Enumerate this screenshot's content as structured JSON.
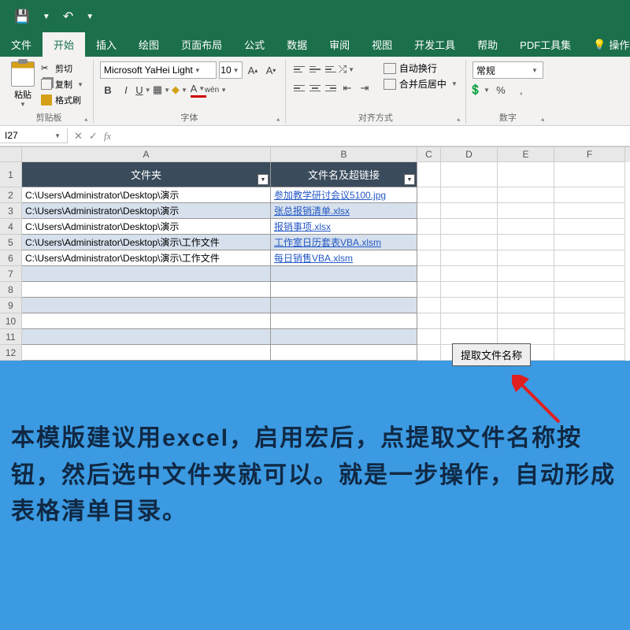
{
  "title_bar": {
    "save_icon": "💾",
    "undo_icon": "↶"
  },
  "tabs": {
    "file": "文件",
    "home": "开始",
    "insert": "插入",
    "draw": "绘图",
    "layout": "页面布局",
    "formulas": "公式",
    "data": "数据",
    "review": "审阅",
    "view": "视图",
    "dev": "开发工具",
    "help": "帮助",
    "pdf": "PDF工具集",
    "tell": "操作说明"
  },
  "ribbon": {
    "clipboard": {
      "paste": "粘贴",
      "cut": "剪切",
      "copy": "复制",
      "brush": "格式刷",
      "label": "剪贴板"
    },
    "font": {
      "name": "Microsoft YaHei Light",
      "size": "10",
      "label": "字体",
      "wen": "wén"
    },
    "align": {
      "wrap": "自动换行",
      "merge": "合并后居中",
      "label": "对齐方式"
    },
    "number": {
      "format": "常规",
      "label": "数字"
    }
  },
  "namebox": {
    "cell": "I27"
  },
  "headers": {
    "A": "A",
    "B": "B",
    "C": "C",
    "D": "D",
    "E": "E",
    "F": "F"
  },
  "table_headers": {
    "folder": "文件夹",
    "filename": "文件名及超链接"
  },
  "rows": [
    {
      "n": "1"
    },
    {
      "n": "2",
      "folder": "C:\\Users\\Administrator\\Desktop\\演示",
      "file": "参加教学研讨会议5100.jpg",
      "alt": false
    },
    {
      "n": "3",
      "folder": "C:\\Users\\Administrator\\Desktop\\演示",
      "file": "张总报销清单.xlsx",
      "alt": true
    },
    {
      "n": "4",
      "folder": "C:\\Users\\Administrator\\Desktop\\演示",
      "file": "报销事项.xlsx",
      "alt": false
    },
    {
      "n": "5",
      "folder": "C:\\Users\\Administrator\\Desktop\\演示\\工作文件",
      "file": "工作室日历套表VBA.xlsm",
      "alt": true
    },
    {
      "n": "6",
      "folder": "C:\\Users\\Administrator\\Desktop\\演示\\工作文件",
      "file": "每日销售VBA.xlsm",
      "alt": false
    },
    {
      "n": "7",
      "alt": true
    },
    {
      "n": "8",
      "alt": false
    },
    {
      "n": "9",
      "alt": true
    },
    {
      "n": "10",
      "alt": false
    },
    {
      "n": "11",
      "alt": true
    },
    {
      "n": "12",
      "alt": false
    }
  ],
  "button": {
    "extract": "提取文件名称"
  },
  "instruction": "本模版建议用excel，启用宏后，点提取文件名称按钮，然后选中文件夹就可以。就是一步操作，自动形成表格清单目录。"
}
